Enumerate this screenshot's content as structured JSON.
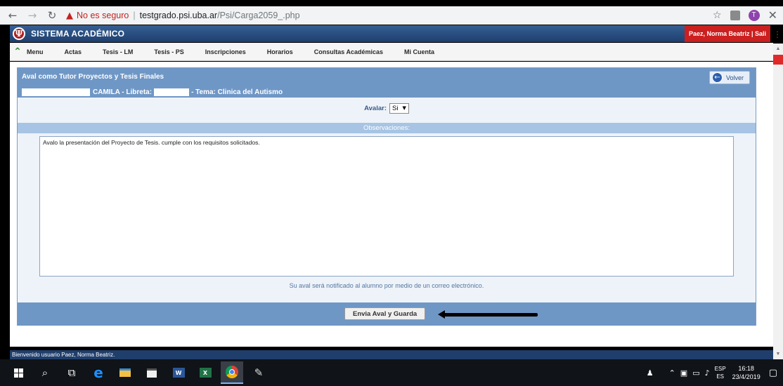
{
  "browser": {
    "insecure_label": "No es seguro",
    "separator": "|",
    "url_host": "testgrado.psi.uba.ar",
    "url_path": "/Psi/Carga2059_.php",
    "profile_initial": "T"
  },
  "app": {
    "logo_glyph": "Ψ",
    "title": "SISTEMA ACADÉMICO",
    "user_label": "Paez, Norma Beatriz  | Sali"
  },
  "menu": {
    "items": [
      "Menu",
      "Actas",
      "Tesis - LM",
      "Tesis - PS",
      "Inscripciones",
      "Horarios",
      "Consultas Académicas",
      "Mi Cuenta"
    ]
  },
  "panel": {
    "title": "Aval como Tutor Proyectos y Tesis Finales",
    "back_label": "Volver",
    "student_name": "CAMILA - Libreta:",
    "theme": "- Tema: Clinica del Autismo",
    "avalar_label": "Avalar:",
    "avalar_value": "Si",
    "obs_header": "Observaciones:",
    "obs_text": "Avalo la presentación del Proyecto de Tesis. cumple con los requisitos solicitados.",
    "notify_text": "Su aval será notificado al alumno por medio de un correo electrónico.",
    "submit_label": "Envia Aval y Guarda"
  },
  "status_bar": {
    "text": "Bienvenido usuario Paez, Norma Beatriz."
  },
  "taskbar": {
    "lang_top": "ESP",
    "lang_bottom": "ES",
    "time": "16:18",
    "date": "23/4/2019"
  },
  "colors": {
    "header_blue": "#1e3f6e",
    "panel_blue": "#6f97c6",
    "user_red": "#cc1f1f"
  }
}
